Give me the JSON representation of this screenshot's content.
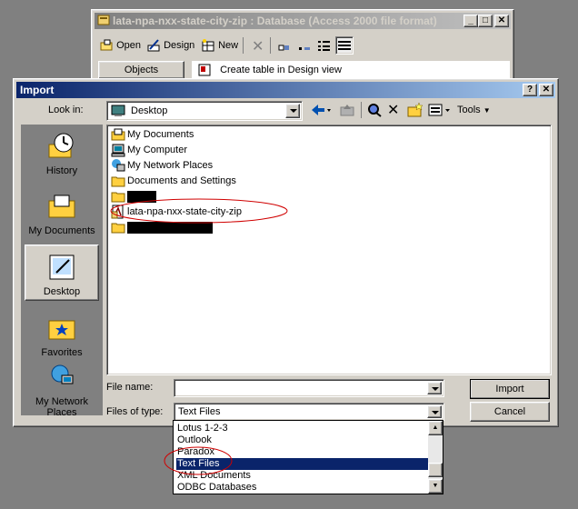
{
  "bg_window": {
    "title": "lata-npa-nxx-state-city-zip : Database (Access 2000 file format)",
    "toolbar": {
      "open": "Open",
      "design": "Design",
      "new": "New"
    },
    "objects_label": "Objects",
    "create_item": "Create table in Design view"
  },
  "dialog": {
    "title": "Import",
    "look_in_label": "Look in:",
    "look_in_value": "Desktop",
    "tools_label": "Tools",
    "places": [
      {
        "label": "History",
        "icon": "history-icon"
      },
      {
        "label": "My Documents",
        "icon": "my-documents-icon"
      },
      {
        "label": "Desktop",
        "icon": "desktop-icon"
      },
      {
        "label": "Favorites",
        "icon": "favorites-icon"
      },
      {
        "label": "My Network Places",
        "icon": "network-places-icon"
      }
    ],
    "files": [
      {
        "name": "My Documents",
        "icon": "folder-documents-icon"
      },
      {
        "name": "My Computer",
        "icon": "computer-icon"
      },
      {
        "name": "My Network Places",
        "icon": "network-icon"
      },
      {
        "name": "Documents and Settings",
        "icon": "folder-icon"
      },
      {
        "name": "",
        "icon": "folder-icon",
        "redacted": true
      },
      {
        "name": "lata-npa-nxx-state-city-zip",
        "icon": "access-db-icon"
      },
      {
        "name": "",
        "icon": "folder-icon",
        "redacted": true
      }
    ],
    "file_name_label": "File name:",
    "file_name_value": "",
    "files_of_type_label": "Files of type:",
    "files_of_type_value": "Text Files",
    "type_options": [
      "Lotus 1-2-3",
      "Outlook",
      "Paradox",
      "Text Files",
      "XML Documents",
      "ODBC Databases"
    ],
    "selected_option": "Text Files",
    "import_button": "Import",
    "cancel_button": "Cancel"
  },
  "colors": {
    "selection": "#0a246a",
    "annotation": "#d00000",
    "face": "#d4d0c8"
  }
}
